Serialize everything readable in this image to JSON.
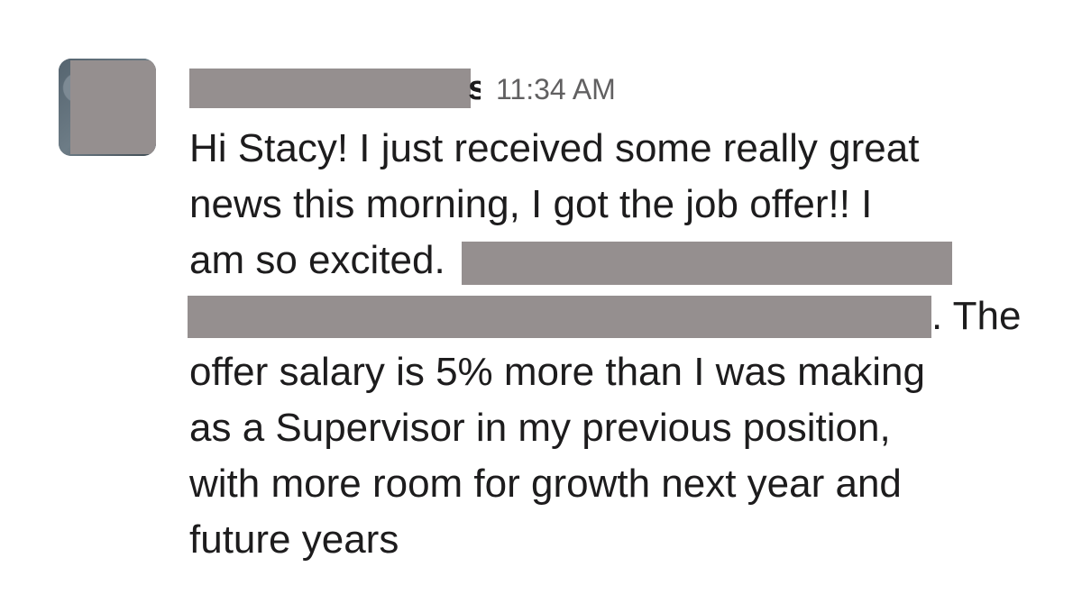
{
  "message": {
    "sender_visible_tail": "s",
    "timestamp": "11:34 AM",
    "body": {
      "line1": "Hi Stacy! I just received some really great",
      "line2": "news this morning, I got the job offer!! I",
      "line3": "am so excited.",
      "line4_end": ". The",
      "line5": "offer salary is 5% more than I was making",
      "line6": "as a Supervisor in my previous position,",
      "line7": "with more room for growth next year and",
      "line8": "future years"
    }
  },
  "colors": {
    "redaction": "#958f8f",
    "text": "#1d1c1d",
    "timestamp": "#616061",
    "background": "#ffffff"
  },
  "icons": {
    "avatar": "avatar-photo"
  }
}
